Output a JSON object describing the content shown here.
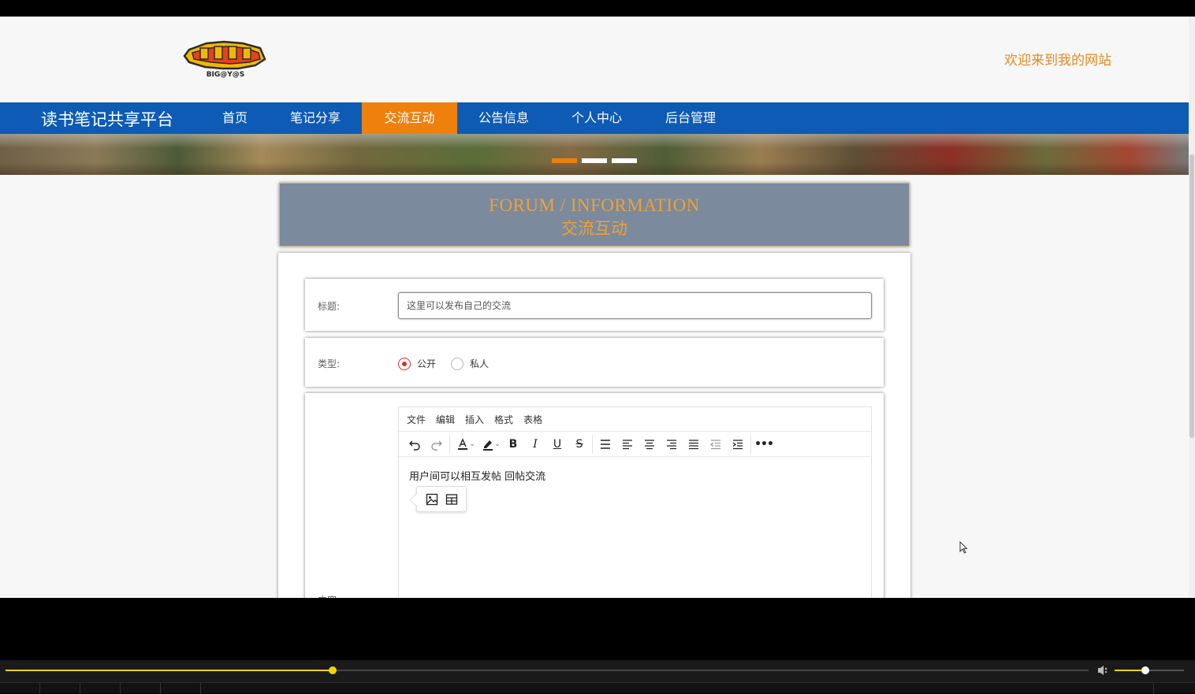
{
  "header": {
    "logo_text": "BIG@Y@S",
    "welcome": "欢迎来到我的网站"
  },
  "navbar": {
    "brand": "读书笔记共享平台",
    "items": [
      {
        "label": "首页",
        "active": false
      },
      {
        "label": "笔记分享",
        "active": false
      },
      {
        "label": "交流互动",
        "active": true
      },
      {
        "label": "公告信息",
        "active": false
      },
      {
        "label": "个人中心",
        "active": false
      },
      {
        "label": "后台管理",
        "active": false
      }
    ],
    "accent": "#f0800c",
    "bar_color": "#0d5bb5"
  },
  "banner": {
    "slides": 3,
    "active_slide": 1
  },
  "page_title": {
    "en": "FORUM / INFORMATION",
    "cn": "交流互动"
  },
  "form": {
    "title_label": "标题:",
    "title_value": "这里可以发布自己的交流",
    "type_label": "类型:",
    "type_options": [
      "公开",
      "私人"
    ],
    "type_selected": "公开",
    "content_label": "内容",
    "editor": {
      "menu": [
        "文件",
        "编辑",
        "插入",
        "格式",
        "表格"
      ],
      "toolbar_icons": [
        "undo-icon",
        "redo-icon",
        "text-color-icon",
        "highlight-icon",
        "bold-icon",
        "italic-icon",
        "underline-icon",
        "strikethrough-icon",
        "list-icon",
        "align-left-icon",
        "align-center-icon",
        "align-right-icon",
        "align-justify-icon",
        "outdent-icon",
        "indent-icon",
        "more-icon"
      ],
      "body_text": "用户间可以相互发帖 回帖交流",
      "quick_insert": [
        "image-icon",
        "table-icon"
      ]
    }
  },
  "player": {
    "progress": 0.302,
    "volume": 0.44,
    "accent": "#f2d300"
  }
}
